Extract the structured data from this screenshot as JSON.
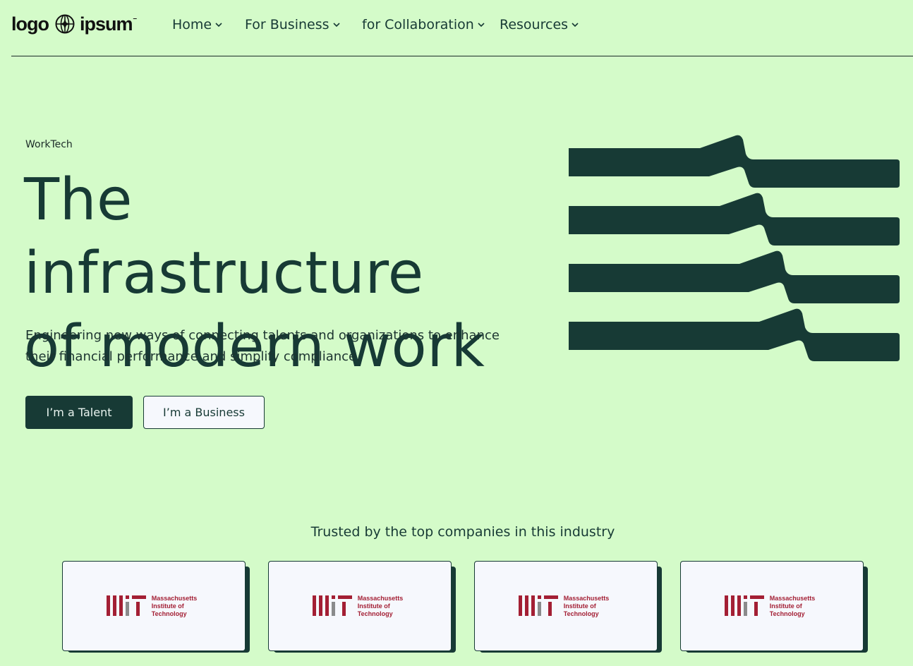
{
  "logo": {
    "left": "logo",
    "right": "ipsum"
  },
  "nav": {
    "items": [
      {
        "label": "Home"
      },
      {
        "label": "For Business"
      },
      {
        "label": "for Collaboration"
      },
      {
        "label": "Resources"
      }
    ]
  },
  "hero": {
    "eyebrow": "WorkTech",
    "title_line1": "The infrastructure",
    "title_line2": "of modern work",
    "subtitle_line1": "Engineering new ways of connecting talents and organizations to enhance",
    "subtitle_line2": "their financial performance and simplify compliance.",
    "primary_cta": "I’m a Talent",
    "secondary_cta": "I’m a Business"
  },
  "trusted": {
    "heading": "Trusted by the top companies in this industry",
    "companies": [
      {
        "line1": "Massachusetts",
        "line2": "Institute of",
        "line3": "Technology"
      },
      {
        "line1": "Massachusetts",
        "line2": "Institute of",
        "line3": "Technology"
      },
      {
        "line1": "Massachusetts",
        "line2": "Institute of",
        "line3": "Technology"
      },
      {
        "line1": "Massachusetts",
        "line2": "Institute of",
        "line3": "Technology"
      }
    ]
  },
  "colors": {
    "background": "#d4fbc9",
    "primary": "#173a35",
    "card": "#f6f8fd",
    "mit_red": "#a31f34",
    "mit_gray": "#8a8b8c"
  }
}
